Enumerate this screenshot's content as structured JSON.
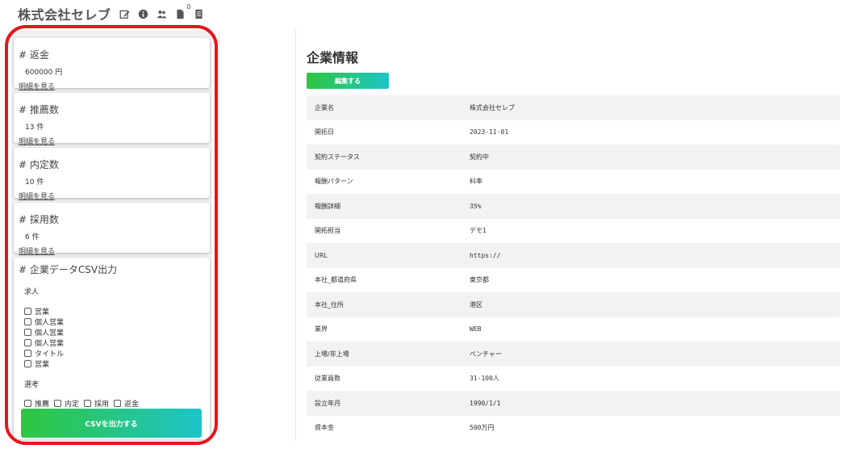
{
  "header": {
    "title": "株式会社セレブ",
    "icons": [
      "edit-icon",
      "info-icon",
      "users-icon",
      "document-icon",
      "list-icon"
    ],
    "document_count": "0"
  },
  "summary_cards": [
    {
      "title": "# 返金",
      "value": "600000 円",
      "link": "明細を見る"
    },
    {
      "title": "# 推薦数",
      "value": "13 件",
      "link": "明細を見る"
    },
    {
      "title": "# 内定数",
      "value": "10 件",
      "link": "明細を見る"
    },
    {
      "title": "# 採用数",
      "value": "6 件",
      "link": "明細を見る"
    }
  ],
  "csv_export": {
    "title": "# 企業データCSV出力",
    "jobs_label": "求人",
    "jobs_options": [
      "営業",
      "個人営業",
      "個人営業",
      "個人営業",
      "タイトル",
      "営業"
    ],
    "selection_label": "選考",
    "selection_options": [
      "推薦",
      "内定",
      "採用",
      "返金"
    ],
    "button_label": "CSVを出力する"
  },
  "company_info": {
    "title": "企業情報",
    "edit_label": "編集する",
    "rows": [
      {
        "key": "企業名",
        "value": "株式会社セレブ"
      },
      {
        "key": "開拓日",
        "value": "2023-11-01"
      },
      {
        "key": "契約ステータス",
        "value": "契約中"
      },
      {
        "key": "報酬パターン",
        "value": "料率"
      },
      {
        "key": "報酬詳細",
        "value": "35%"
      },
      {
        "key": "開拓担当",
        "value": "デモ1"
      },
      {
        "key": "URL",
        "value": "https://"
      },
      {
        "key": "本社_都道府県",
        "value": "東京都"
      },
      {
        "key": "本社_住所",
        "value": "港区"
      },
      {
        "key": "業界",
        "value": "WEB"
      },
      {
        "key": "上場/非上場",
        "value": "ベンチャー"
      },
      {
        "key": "従業員数",
        "value": "31-100人"
      },
      {
        "key": "設立年月",
        "value": "1990/1/1"
      },
      {
        "key": "資本金",
        "value": "500万円"
      }
    ]
  },
  "colors": {
    "button_gradient_start": "#2ec63f",
    "button_gradient_end": "#1ec4c8",
    "annotation_border": "#e8141b",
    "stripe": "#f2f2f2"
  }
}
